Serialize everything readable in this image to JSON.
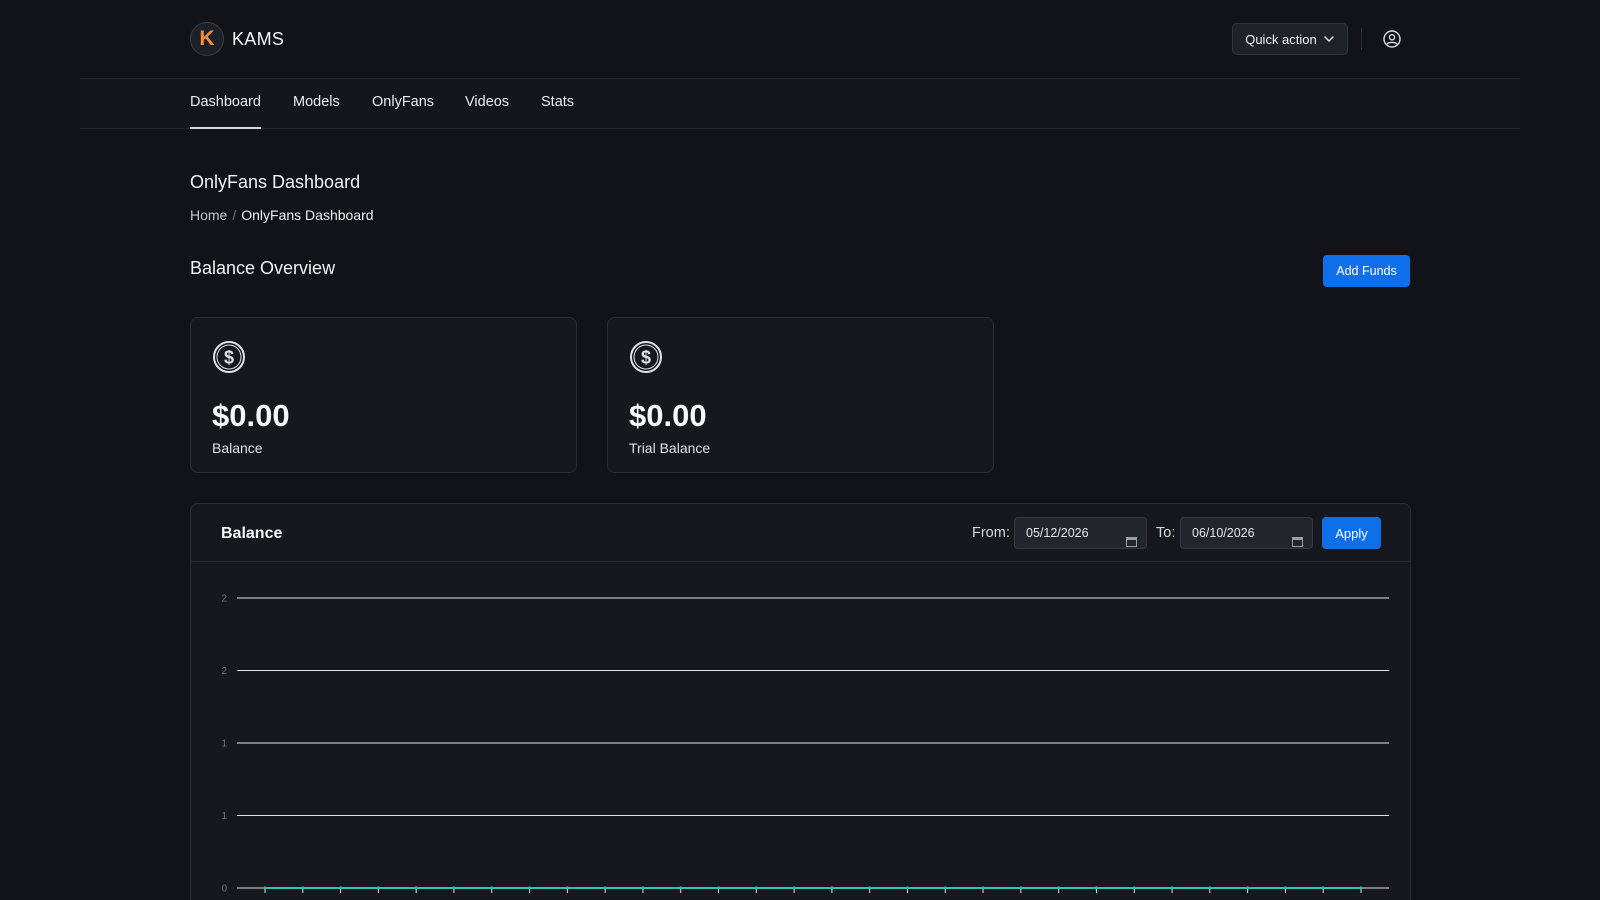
{
  "brand": {
    "name": "KAMS",
    "logo_letter": "K"
  },
  "header": {
    "quick_action_label": "Quick action"
  },
  "nav": {
    "items": [
      {
        "label": "Dashboard",
        "active": true
      },
      {
        "label": "Models",
        "active": false
      },
      {
        "label": "OnlyFans",
        "active": false
      },
      {
        "label": "Videos",
        "active": false
      },
      {
        "label": "Stats",
        "active": false
      }
    ]
  },
  "page": {
    "title": "OnlyFans Dashboard",
    "breadcrumb": {
      "home": "Home",
      "separator": "/",
      "current": "OnlyFans Dashboard"
    }
  },
  "balance_overview": {
    "title": "Balance Overview",
    "add_funds_label": "Add Funds",
    "cards": [
      {
        "amount": "$0.00",
        "label": "Balance",
        "icon": "dollar-circle-icon"
      },
      {
        "amount": "$0.00",
        "label": "Trial Balance",
        "icon": "dollar-circle-icon"
      }
    ]
  },
  "balance_chart_panel": {
    "title": "Balance",
    "from_label": "From:",
    "from_value": "05/12/2026",
    "to_label": "To:",
    "to_value": "06/10/2026",
    "apply_label": "Apply"
  },
  "colors": {
    "background": "#111318",
    "accent": "#0f6fe8",
    "logo_orange": "#f28b3a",
    "series_line": "#2fc3b4"
  },
  "chart_data": {
    "type": "line",
    "y_tick_labels": [
      "2",
      "2",
      "1",
      "1",
      "0"
    ],
    "ylim": [
      0,
      2
    ],
    "series": [
      {
        "values": [
          0,
          0,
          0,
          0,
          0,
          0,
          0,
          0,
          0,
          0,
          0,
          0,
          0,
          0,
          0,
          0,
          0,
          0,
          0,
          0,
          0,
          0,
          0,
          0,
          0,
          0,
          0,
          0,
          0,
          0
        ]
      }
    ],
    "grid": true
  }
}
